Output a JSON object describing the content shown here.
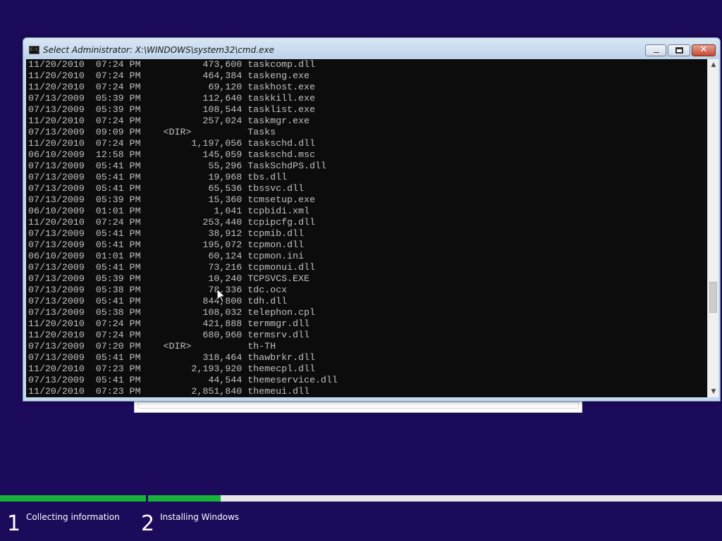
{
  "window": {
    "title": "Select Administrator: X:\\WINDOWS\\system32\\cmd.exe",
    "close_glyph": "✕",
    "icon": "cmd-icon",
    "icon_text": "C:\\"
  },
  "console_lines": [
    "11/20/2010  07:24 PM           473,600 taskcomp.dll",
    "11/20/2010  07:24 PM           464,384 taskeng.exe",
    "11/20/2010  07:24 PM            69,120 taskhost.exe",
    "07/13/2009  05:39 PM           112,640 taskkill.exe",
    "07/13/2009  05:39 PM           108,544 tasklist.exe",
    "11/20/2010  07:24 PM           257,024 taskmgr.exe",
    "07/13/2009  09:09 PM    <DIR>          Tasks",
    "11/20/2010  07:24 PM         1,197,056 taskschd.dll",
    "06/10/2009  12:58 PM           145,059 taskschd.msc",
    "07/13/2009  05:41 PM            55,296 TaskSchdPS.dll",
    "07/13/2009  05:41 PM            19,968 tbs.dll",
    "07/13/2009  05:41 PM            65,536 tbssvc.dll",
    "07/13/2009  05:39 PM            15,360 tcmsetup.exe",
    "06/10/2009  01:01 PM             1,041 tcpbidi.xml",
    "11/20/2010  07:24 PM           253,440 tcpipcfg.dll",
    "07/13/2009  05:41 PM            38,912 tcpmib.dll",
    "07/13/2009  05:41 PM           195,072 tcpmon.dll",
    "06/10/2009  01:01 PM            60,124 tcpmon.ini",
    "07/13/2009  05:41 PM            73,216 tcpmonui.dll",
    "07/13/2009  05:39 PM            10,240 TCPSVCS.EXE",
    "07/13/2009  05:38 PM            78,336 tdc.ocx",
    "07/13/2009  05:41 PM           844,800 tdh.dll",
    "07/13/2009  05:38 PM           108,032 telephon.cpl",
    "11/20/2010  07:24 PM           421,888 termmgr.dll",
    "11/20/2010  07:24 PM           680,960 termsrv.dll",
    "07/13/2009  07:20 PM    <DIR>          th-TH",
    "07/13/2009  05:41 PM           318,464 thawbrkr.dll",
    "11/20/2010  07:23 PM         2,193,920 themecpl.dll",
    "07/13/2009  05:41 PM            44,544 themeservice.dll",
    "11/20/2010  07:23 PM         2,851,840 themeui.dll"
  ],
  "scrollbar": {
    "up_glyph": "▲",
    "down_glyph": "▼"
  },
  "setup_progress": {
    "steps": [
      {
        "number": "1",
        "label": "Collecting information",
        "progress": 1.0
      },
      {
        "number": "2",
        "label": "Installing Windows",
        "progress": 0.12
      }
    ]
  },
  "colors": {
    "background": "#1c0a5a",
    "progress": "#17b33a",
    "console_bg": "#0c0c0c",
    "console_text": "#c0c0c0"
  }
}
